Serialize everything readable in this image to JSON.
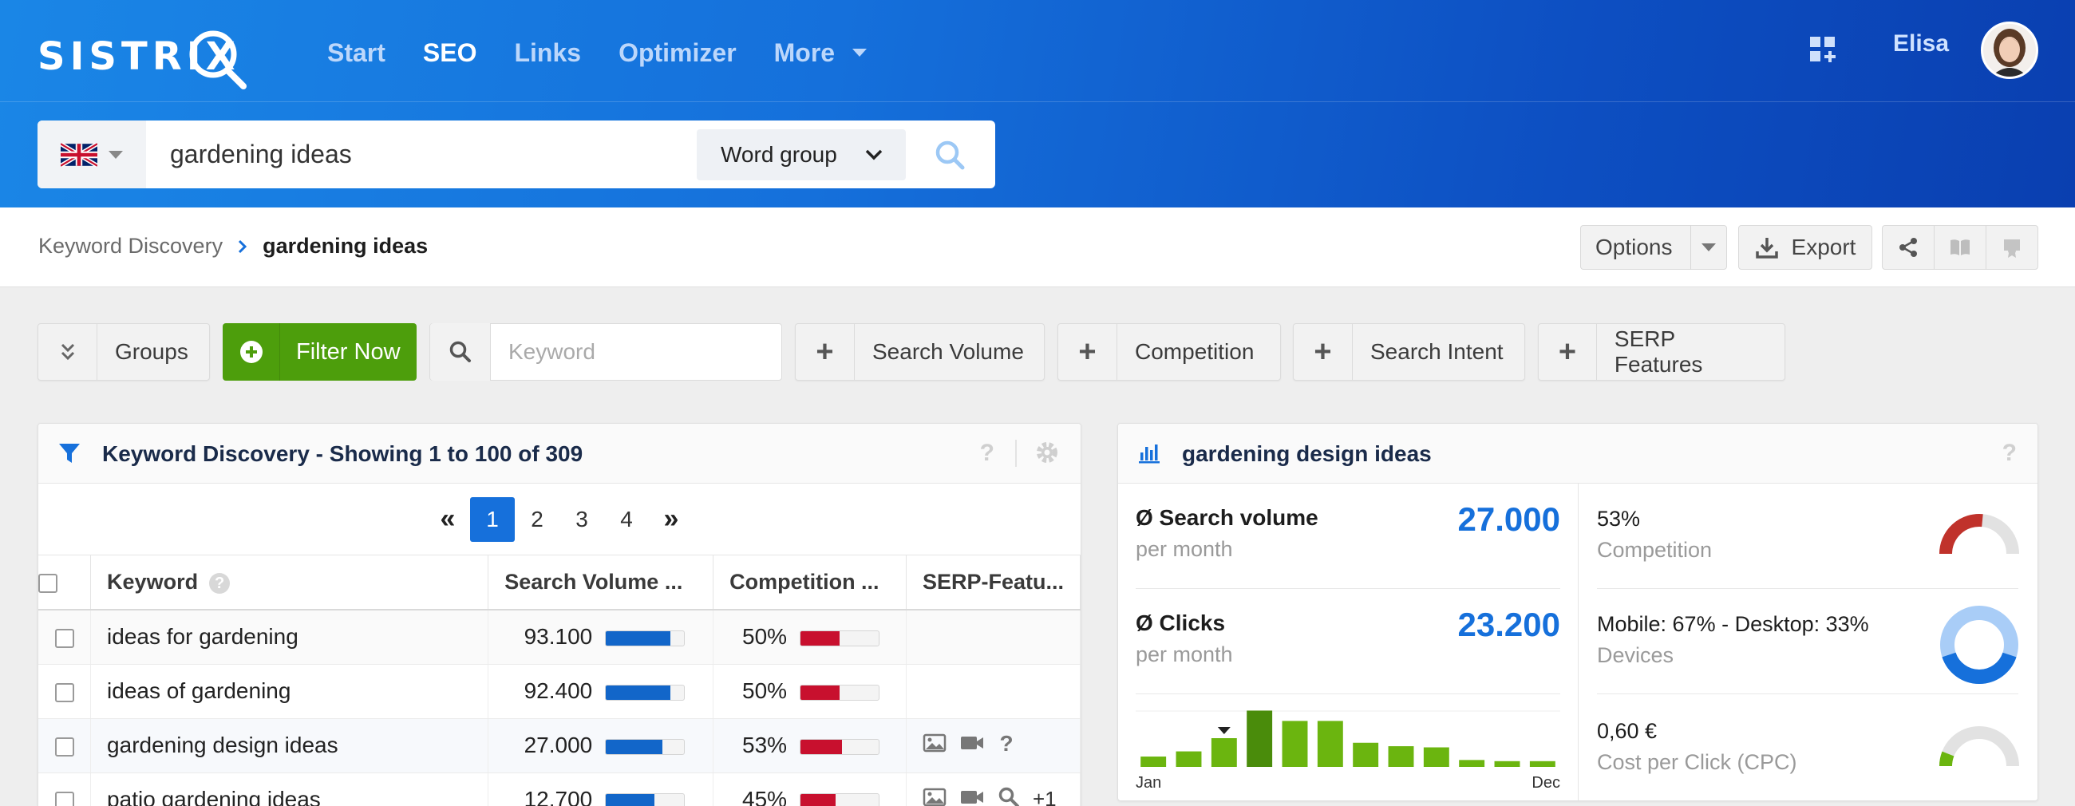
{
  "header": {
    "logo_text": "SISTRIX",
    "nav": [
      {
        "label": "Start",
        "active": false
      },
      {
        "label": "SEO",
        "active": true
      },
      {
        "label": "Links",
        "active": false
      },
      {
        "label": "Optimizer",
        "active": false
      },
      {
        "label": "More",
        "active": false
      }
    ],
    "user_name": "Elisa",
    "apps_icon": "grid-plus-icon"
  },
  "search": {
    "country": "United Kingdom",
    "flag_icon": "uk-flag-icon",
    "query": "gardening ideas",
    "mode": "Word group",
    "submit_icon": "search-icon"
  },
  "breadcrumb": {
    "parent": "Keyword Discovery",
    "current": "gardening ideas"
  },
  "toolbar": {
    "options_label": "Options",
    "export_label": "Export",
    "icons": [
      "share-icon",
      "book-icon",
      "certificate-icon"
    ]
  },
  "filters": {
    "groups_label": "Groups",
    "filter_now_label": "Filter Now",
    "keyword_placeholder": "Keyword",
    "search_volume_label": "Search Volume",
    "competition_label": "Competition",
    "search_intent_label": "Search Intent",
    "serp_features_label": "SERP Features"
  },
  "table_panel": {
    "title": "Keyword Discovery - Showing 1 to 100 of 309",
    "pages": [
      "1",
      "2",
      "3",
      "4"
    ],
    "current_page": "1",
    "columns": {
      "keyword": "Keyword",
      "search_volume": "Search Volume ...",
      "competition": "Competition ...",
      "serp_features": "SERP-Featu..."
    },
    "rows": [
      {
        "keyword": "ideas for gardening",
        "volume": "93.100",
        "volume_fill": 0.82,
        "competition": "50%",
        "competition_fill": 0.5,
        "serp": [],
        "serp_more": ""
      },
      {
        "keyword": "ideas of gardening",
        "volume": "92.400",
        "volume_fill": 0.82,
        "competition": "50%",
        "competition_fill": 0.5,
        "serp": [],
        "serp_more": ""
      },
      {
        "keyword": "gardening design ideas",
        "volume": "27.000",
        "volume_fill": 0.72,
        "competition": "53%",
        "competition_fill": 0.53,
        "serp": [
          "image-icon",
          "video-icon",
          "question-icon"
        ],
        "serp_more": ""
      },
      {
        "keyword": "patio gardening ideas",
        "volume": "12.700",
        "volume_fill": 0.62,
        "competition": "45%",
        "competition_fill": 0.45,
        "serp": [
          "image-icon",
          "video-icon",
          "magnifier-icon"
        ],
        "serp_more": "+1"
      }
    ]
  },
  "detail_panel": {
    "title": "gardening design ideas",
    "search_volume": {
      "label": "Ø Search volume",
      "sub": "per month",
      "value": "27.000"
    },
    "clicks": {
      "label": "Ø Clicks",
      "sub": "per month",
      "value": "23.200"
    },
    "monthly_bars": [
      0.18,
      0.27,
      0.5,
      0.98,
      0.8,
      0.8,
      0.42,
      0.36,
      0.34,
      0.12,
      0.1,
      0.1
    ],
    "highlight_month_index": 2,
    "month_start": "Jan",
    "month_end": "Dec",
    "competition": {
      "value": "53%",
      "sub": "Competition",
      "fraction": 0.53
    },
    "devices": {
      "value": "Mobile: 67% - Desktop: 33%",
      "sub": "Devices",
      "mobile": 0.67
    },
    "cpc": {
      "value": "0,60 €",
      "sub": "Cost per Click (CPC)",
      "fraction": 0.12
    }
  },
  "colors": {
    "primary": "#1670db",
    "green": "#4d9e0c",
    "bar_green": "#6bb50f",
    "bar_green_dark": "#4a8c0b",
    "red": "#c8102e",
    "competition_red": "#c0322b",
    "devices_light": "#a9cdf7"
  }
}
